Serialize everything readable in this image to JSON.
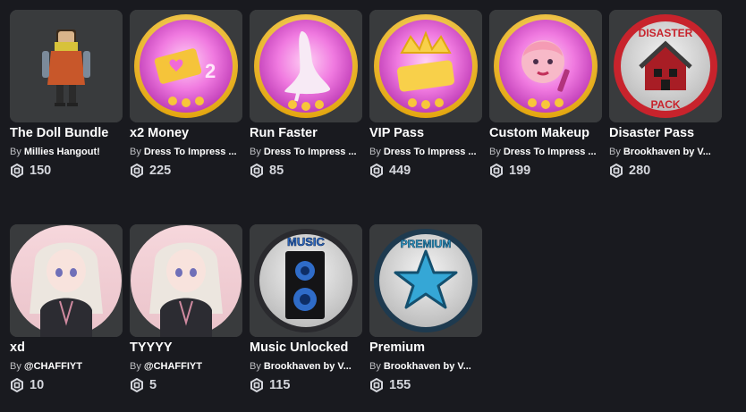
{
  "items": [
    {
      "title": "The Doll Bundle",
      "by": "By",
      "creator": "Millies Hangout!",
      "price": "150",
      "icon": "robux-icon"
    },
    {
      "title": "x2 Money",
      "by": "By",
      "creator": "Dress To Impress ...",
      "price": "225",
      "icon": "robux-icon"
    },
    {
      "title": "Run Faster",
      "by": "By",
      "creator": "Dress To Impress ...",
      "price": "85",
      "icon": "robux-icon"
    },
    {
      "title": "VIP Pass",
      "by": "By",
      "creator": "Dress To Impress ...",
      "price": "449",
      "icon": "robux-icon"
    },
    {
      "title": "Custom Makeup",
      "by": "By",
      "creator": "Dress To Impress ...",
      "price": "199",
      "icon": "robux-icon"
    },
    {
      "title": "Disaster Pass",
      "by": "By",
      "creator": "Brookhaven by V...",
      "price": "280",
      "icon": "robux-icon",
      "badge_top": "DISASTER",
      "badge_bottom": "PACK"
    },
    {
      "title": "xd",
      "by": "By",
      "creator": "@CHAFFIYT",
      "price": "10",
      "icon": "robux-icon"
    },
    {
      "title": "TYYYY",
      "by": "By",
      "creator": "@CHAFFIYT",
      "price": "5",
      "icon": "robux-icon"
    },
    {
      "title": "Music Unlocked",
      "by": "By",
      "creator": "Brookhaven by V...",
      "price": "115",
      "icon": "robux-icon",
      "badge_top": "MUSIC"
    },
    {
      "title": "Premium",
      "by": "By",
      "creator": "Brookhaven by V...",
      "price": "155",
      "icon": "robux-icon",
      "badge_top": "PREMIUM"
    }
  ],
  "colors": {
    "background": "#191a1f",
    "thumb_bg": "#393b3d",
    "gold": "#f2c21a",
    "pink": "#f06ad8",
    "disaster_red": "#c8232c",
    "music_blue": "#3a7bd5",
    "premium_teal": "#35a7d6"
  }
}
